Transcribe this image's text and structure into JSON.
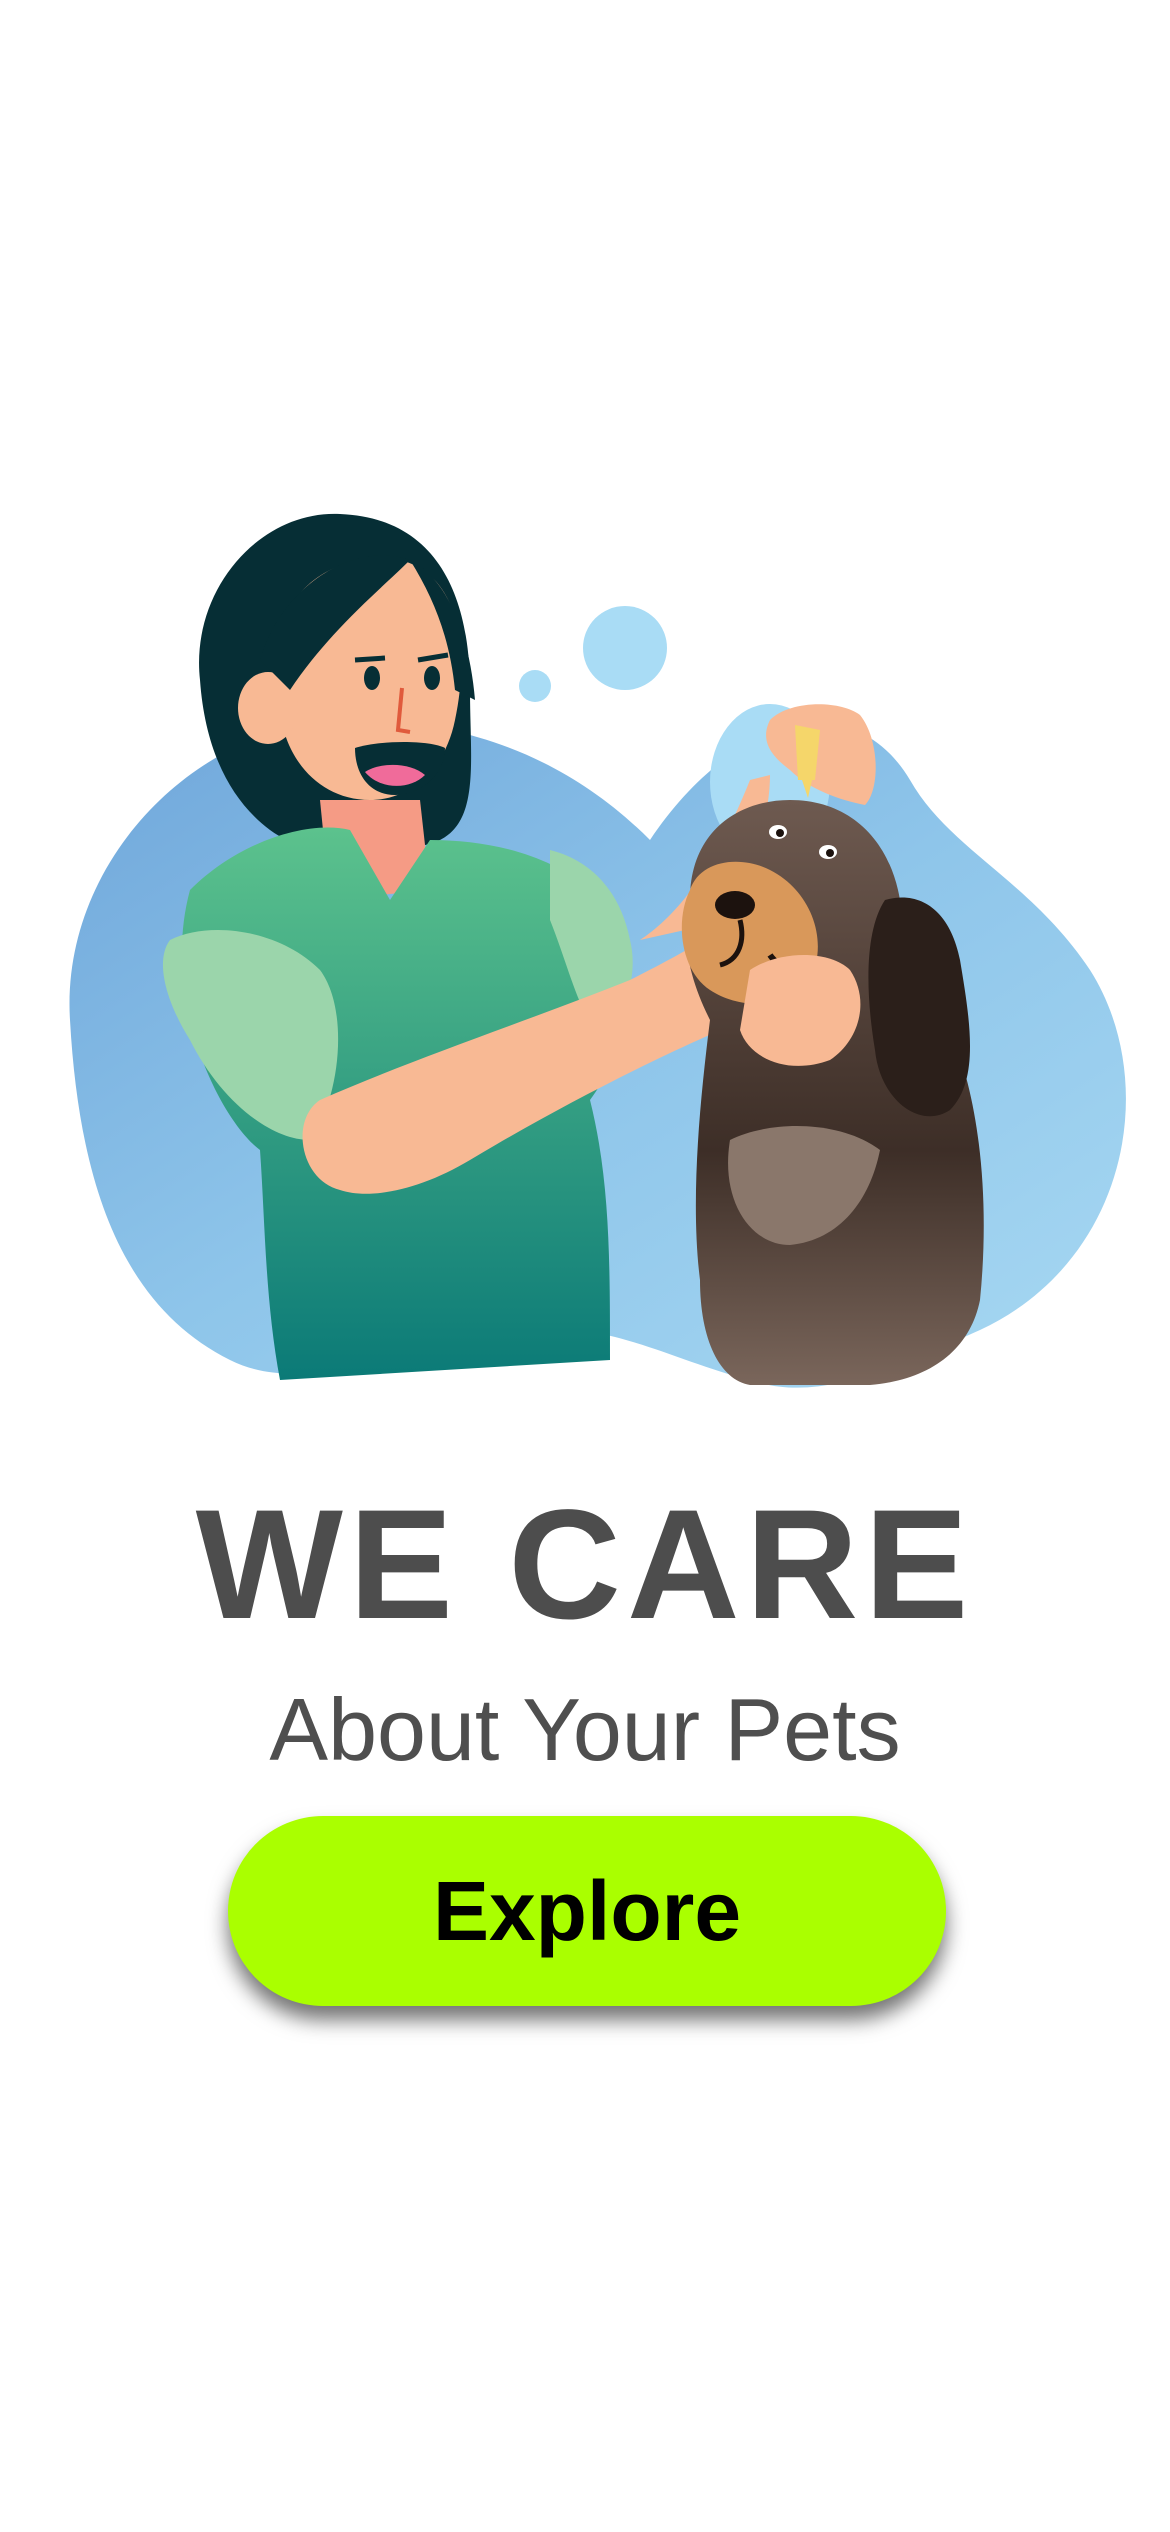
{
  "hero": {
    "illustration": "woman-giving-dog-eye-drops-illustration"
  },
  "headline": "WE CARE",
  "subheadline": "About Your Pets",
  "cta": {
    "label": "Explore"
  },
  "colors": {
    "accent": "#aaff00",
    "headline": "#4d4d4d",
    "blob": "#8ec5ea",
    "shirt": "#2ea87e",
    "dog": "#4a3a33"
  }
}
